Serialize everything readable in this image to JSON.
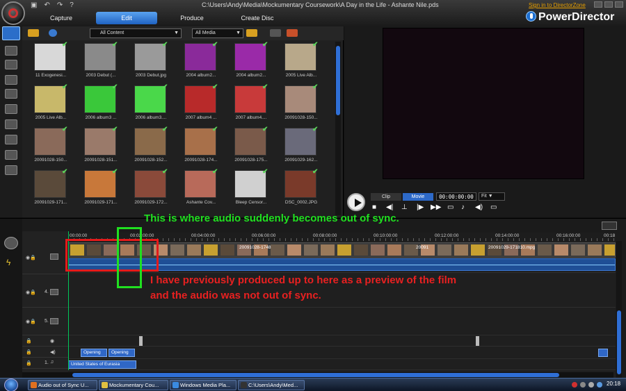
{
  "window": {
    "title": "C:\\Users\\Andy\\Media\\Mockumentary Coursework\\A Day in the Life - Ashante Nile.pds",
    "sign_in": "Sign in to DirectorZone",
    "brand": "PowerDirector"
  },
  "main_tabs": [
    {
      "label": "Capture"
    },
    {
      "label": "Edit",
      "active": true
    },
    {
      "label": "Produce"
    },
    {
      "label": "Create Disc"
    }
  ],
  "library": {
    "filter_content": "All Content",
    "filter_media": "All Media",
    "items": [
      {
        "name": "11 Exogenesi...",
        "thumb": "#d8d8d8"
      },
      {
        "name": "2003 Debut (...",
        "thumb": "#8a8a8a"
      },
      {
        "name": "2003 Debut.jpg",
        "thumb": "#9a9a9a"
      },
      {
        "name": "2004 album2...",
        "thumb": "#8a2a9a"
      },
      {
        "name": "2004 album2...",
        "thumb": "#9a2aa8"
      },
      {
        "name": "2005 Live Alb...",
        "thumb": "#b8a88a"
      },
      {
        "name": "2005 Live Alb...",
        "thumb": "#c8b86a"
      },
      {
        "name": "2006 album3 ...",
        "thumb": "#3ac83a"
      },
      {
        "name": "2006 album3....",
        "thumb": "#4ad84a"
      },
      {
        "name": "2007 album4 ...",
        "thumb": "#b82a2a"
      },
      {
        "name": "2007 album4....",
        "thumb": "#c83a3a"
      },
      {
        "name": "20091028-150...",
        "thumb": "#a88a7a"
      },
      {
        "name": "20091028-150...",
        "thumb": "#8a6a5a"
      },
      {
        "name": "20091028-151...",
        "thumb": "#9a7a6a"
      },
      {
        "name": "20091028-152...",
        "thumb": "#8a6a4a"
      },
      {
        "name": "20091028-174...",
        "thumb": "#a8704a"
      },
      {
        "name": "20091028-175...",
        "thumb": "#7a5a4a"
      },
      {
        "name": "20091029-162...",
        "thumb": "#6a6a7a"
      },
      {
        "name": "20091029-171...",
        "thumb": "#5a4a3a"
      },
      {
        "name": "20091029-171...",
        "thumb": "#c8783a"
      },
      {
        "name": "20091029-172...",
        "thumb": "#8a4a3a"
      },
      {
        "name": "Ashante Cov...",
        "thumb": "#b86a5a"
      },
      {
        "name": "Bleep Censor...",
        "thumb": "#d0d0d0"
      },
      {
        "name": "DSC_0002.JPG",
        "thumb": "#7a3a2a"
      }
    ]
  },
  "preview": {
    "mode_clip": "Clip",
    "mode_movie": "Movie",
    "timecode": "00:00:00:00",
    "fit": "Fit"
  },
  "timeline": {
    "ruler_labels": [
      "00:00:00",
      "00:02:00:00",
      "00:04:00:00",
      "00:06:00:00",
      "00:08:00:00",
      "00:10:00:00",
      "00:12:00:00",
      "00:14:00:00",
      "00:16:00:00",
      "00:18"
    ],
    "track_numbers": [
      "4.",
      "5.",
      "1."
    ],
    "clips": {
      "video_a": "20091028-1748",
      "video_b": "20091029-171810.mpg",
      "video_c": "20091",
      "title_1": "Opening",
      "title_2": "Opening",
      "music": "United States of Eurasia"
    }
  },
  "annotations": {
    "green": "This is where audio suddenly becomes out of sync.",
    "red_line1": "I have previously produced up to here as a preview of the film",
    "red_line2": "and the audio was not out of sync."
  },
  "taskbar": {
    "tasks": [
      {
        "label": "Audio out of Sync U...",
        "color": "#e07020"
      },
      {
        "label": "Mockumentary Cou...",
        "color": "#e0c040"
      },
      {
        "label": "Windows Media Pla...",
        "color": "#3a8ae0"
      },
      {
        "label": "C:\\Users\\Andy\\Med...",
        "color": "#333333"
      }
    ],
    "clock": "20:18"
  }
}
